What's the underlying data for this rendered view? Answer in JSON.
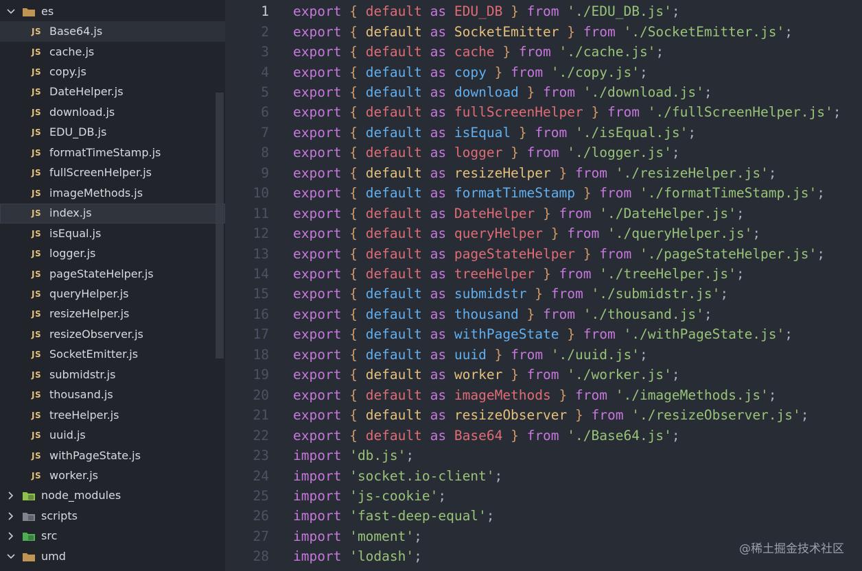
{
  "explorer": {
    "root_folder": "es",
    "files": [
      "Base64.js",
      "cache.js",
      "copy.js",
      "DateHelper.js",
      "download.js",
      "EDU_DB.js",
      "formatTimeStamp.js",
      "fullScreenHelper.js",
      "imageMethods.js",
      "index.js",
      "isEqual.js",
      "logger.js",
      "pageStateHelper.js",
      "queryHelper.js",
      "resizeHelper.js",
      "resizeObserver.js",
      "SocketEmitter.js",
      "submidstr.js",
      "thousand.js",
      "treeHelper.js",
      "uuid.js",
      "withPageState.js",
      "worker.js"
    ],
    "file_icon_text": "JS",
    "folders": [
      {
        "name": "node_modules",
        "icon": "node-folder-icon",
        "color": "#8dc149"
      },
      {
        "name": "scripts",
        "icon": "scripts-folder-icon",
        "color": "#7f848e"
      },
      {
        "name": "src",
        "icon": "src-folder-icon",
        "color": "#4caf50"
      },
      {
        "name": "umd",
        "icon": "folder-icon",
        "color": "#c09553"
      }
    ]
  },
  "editor": {
    "active_line": 1,
    "exports": [
      {
        "n": 1,
        "name": "EDU_DB",
        "path": "./EDU_DB.js",
        "c": "red"
      },
      {
        "n": 2,
        "name": "SocketEmitter",
        "path": "./SocketEmitter.js",
        "c": "yellow"
      },
      {
        "n": 3,
        "name": "cache",
        "path": "./cache.js",
        "c": "red"
      },
      {
        "n": 4,
        "name": "copy",
        "path": "./copy.js",
        "c": "blue"
      },
      {
        "n": 5,
        "name": "download",
        "path": "./download.js",
        "c": "blue"
      },
      {
        "n": 6,
        "name": "fullScreenHelper",
        "path": "./fullScreenHelper.js",
        "c": "red"
      },
      {
        "n": 7,
        "name": "isEqual",
        "path": "./isEqual.js",
        "c": "blue"
      },
      {
        "n": 8,
        "name": "logger",
        "path": "./logger.js",
        "c": "red"
      },
      {
        "n": 9,
        "name": "resizeHelper",
        "path": "./resizeHelper.js",
        "c": "yellow"
      },
      {
        "n": 10,
        "name": "formatTimeStamp",
        "path": "./formatTimeStamp.js",
        "c": "blue"
      },
      {
        "n": 11,
        "name": "DateHelper",
        "path": "./DateHelper.js",
        "c": "red"
      },
      {
        "n": 12,
        "name": "queryHelper",
        "path": "./queryHelper.js",
        "c": "red"
      },
      {
        "n": 13,
        "name": "pageStateHelper",
        "path": "./pageStateHelper.js",
        "c": "red"
      },
      {
        "n": 14,
        "name": "treeHelper",
        "path": "./treeHelper.js",
        "c": "red"
      },
      {
        "n": 15,
        "name": "submidstr",
        "path": "./submidstr.js",
        "c": "blue"
      },
      {
        "n": 16,
        "name": "thousand",
        "path": "./thousand.js",
        "c": "blue"
      },
      {
        "n": 17,
        "name": "withPageState",
        "path": "./withPageState.js",
        "c": "blue"
      },
      {
        "n": 18,
        "name": "uuid",
        "path": "./uuid.js",
        "c": "blue"
      },
      {
        "n": 19,
        "name": "worker",
        "path": "./worker.js",
        "c": "yellow"
      },
      {
        "n": 20,
        "name": "imageMethods",
        "path": "./imageMethods.js",
        "c": "red"
      },
      {
        "n": 21,
        "name": "resizeObserver",
        "path": "./resizeObserver.js",
        "c": "yellow"
      },
      {
        "n": 22,
        "name": "Base64",
        "path": "./Base64.js",
        "c": "red"
      }
    ],
    "imports": [
      {
        "n": 23,
        "path": "db.js"
      },
      {
        "n": 24,
        "path": "socket.io-client"
      },
      {
        "n": 25,
        "path": "js-cookie"
      },
      {
        "n": 26,
        "path": "fast-deep-equal"
      },
      {
        "n": 27,
        "path": "moment"
      },
      {
        "n": 28,
        "path": "lodash"
      }
    ],
    "keywords": {
      "export": "export",
      "default": "default",
      "as": "as",
      "from": "from",
      "import": "import"
    }
  },
  "watermark": "@稀土掘金技术社区",
  "colors": {
    "background": "#282c34",
    "sidebar": "#21252b",
    "keyword": "#c678dd",
    "string": "#98c379",
    "brace": "#d19a66"
  }
}
